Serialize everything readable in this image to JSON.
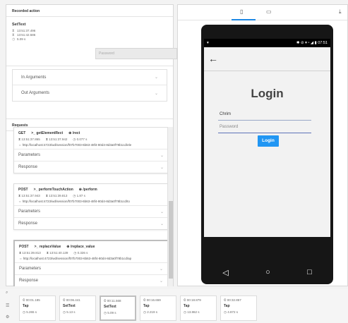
{
  "recorded_action": {
    "title": "Recorded action",
    "action_name": "SetText",
    "start_time": "13:51:37.496",
    "end_time": "13:51:42.586",
    "duration": "5.09 s",
    "input_placeholder": "Password"
  },
  "arguments": {
    "in_label": "In Arguments",
    "out_label": "Out Arguments"
  },
  "requests": {
    "title": "Requests",
    "items": [
      {
        "method": "GET",
        "command": ">_ getElementRect",
        "endpoint": "⊕ /rect",
        "start": "13:51:37.865",
        "end": "13:51:37.942",
        "duration": "0.077 s",
        "url": "http://localhost:4723/wd/session/f07b7003-6b63-48f4-80d4-8d3a0f78b1cd/ele",
        "params_label": "Parameters",
        "response_label": "Response"
      },
      {
        "method": "POST",
        "command": ">_ performTouchAction",
        "endpoint": "⊕ /perform",
        "start": "13:51:37.943",
        "end": "13:51:39.813",
        "duration": "1.87 s",
        "url": "http://localhost:4723/wd/session/f07b7003-6b63-48f4-80d4-8d3a0f78b1cd/to",
        "params_label": "Parameters",
        "response_label": "Response"
      },
      {
        "method": "POST",
        "command": ">_ replaceValue",
        "endpoint": "⊕ /replace_value",
        "start": "13:51:39.813",
        "end": "13:51:40.139",
        "duration": "0.326 s",
        "url": "http://localhost:4723/wd/session/f07b7003-6b63-48f4-80d4-8d3a0f78b1cd/ap",
        "params_label": "Parameters",
        "response_label": "Response"
      }
    ]
  },
  "device": {
    "status_left": "▾",
    "status_right": "✱ ⊘ ▾ ▫ ◢ ▮ 07:51",
    "login_title": "Login",
    "username_value": "Chrim",
    "password_value": "Password",
    "login_button": "Login"
  },
  "timeline": {
    "steps": [
      {
        "time": "00:01.185",
        "name": "Tap",
        "duration": "5.265 s"
      },
      {
        "time": "00:06.441",
        "name": "SetText",
        "duration": "5.13 s"
      },
      {
        "time": "00:11.568",
        "name": "SetText",
        "duration": "5.09 s"
      },
      {
        "time": "00:16.659",
        "name": "Tap",
        "duration": "2.219 s"
      },
      {
        "time": "00:18.879",
        "name": "Tap",
        "duration": "13.862 s"
      },
      {
        "time": "00:32.857",
        "name": "Tap",
        "duration": "4.872 s"
      }
    ]
  }
}
